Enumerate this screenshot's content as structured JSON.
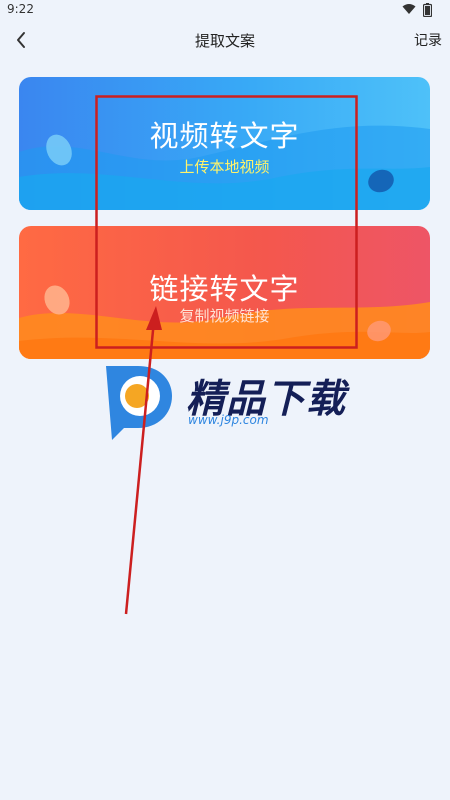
{
  "status_bar": {
    "time": "9:22"
  },
  "header": {
    "back_icon": "chevron-left-icon",
    "title": "提取文案",
    "records_label": "记录"
  },
  "cards": [
    {
      "title": "视频转文字",
      "subtitle": "上传本地视频",
      "color": "#3a9af3"
    },
    {
      "title": "链接转文字",
      "subtitle": "复制视频链接",
      "color": "#f4574d"
    }
  ],
  "watermark": {
    "name": "精品下载",
    "url": "www.j9p.com"
  },
  "annotation": {
    "color": "#cc1f1f"
  }
}
